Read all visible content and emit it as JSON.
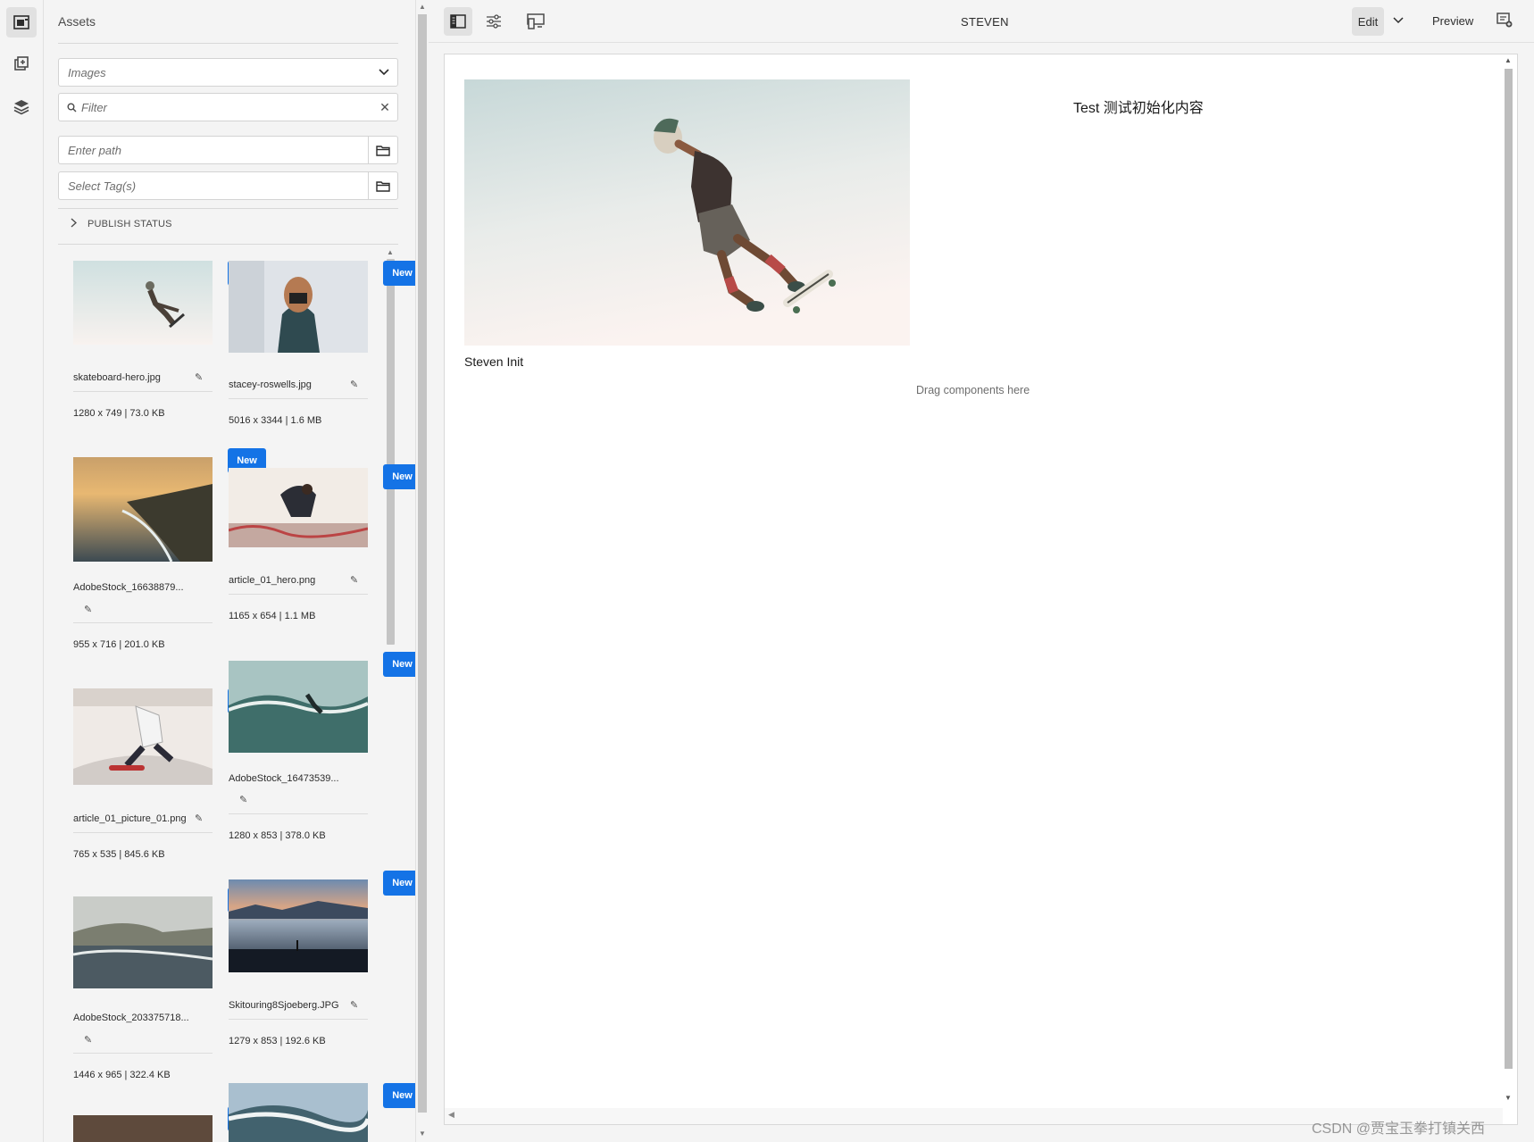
{
  "app": {
    "page_title": "STEVEN"
  },
  "rail": {
    "items": [
      {
        "name": "assets-finder-icon",
        "active": true
      },
      {
        "name": "components-icon",
        "active": false
      },
      {
        "name": "content-tree-icon",
        "active": false
      }
    ]
  },
  "panel": {
    "title": "Assets",
    "asset_type": "Images",
    "filter_placeholder": "Filter",
    "path_placeholder": "Enter path",
    "tags_placeholder": "Select Tag(s)",
    "publish_status_label": "PUBLISH STATUS",
    "badge_label": "New",
    "assets": [
      {
        "name": "skateboard-hero.jpg",
        "meta": "1280 x 749 | 73.0 KB"
      },
      {
        "name": "stacey-roswells.jpg",
        "meta": "5016 x 3344 | 1.6 MB"
      },
      {
        "name": "AdobeStock_16638879...",
        "meta": "955 x 716 | 201.0 KB"
      },
      {
        "name": "article_01_hero.png",
        "meta": "1165 x 654 | 1.1 MB"
      },
      {
        "name": "article_01_picture_01.png",
        "meta": "765 x 535 | 845.6 KB"
      },
      {
        "name": "AdobeStock_16473539...",
        "meta": "1280 x 853 | 378.0 KB"
      },
      {
        "name": "AdobeStock_203375718...",
        "meta": "1446 x 965 | 322.4 KB"
      },
      {
        "name": "Skitouring8Sjoeberg.JPG",
        "meta": "1279 x 853 | 192.6 KB"
      }
    ]
  },
  "toolbar": {
    "edit_label": "Edit",
    "preview_label": "Preview"
  },
  "canvas": {
    "hero_text": "Test 测试初始化内容",
    "title_text": "Steven Init",
    "drag_hint": "Drag components here"
  },
  "watermark": "CSDN @贾宝玉拳打镇关西"
}
